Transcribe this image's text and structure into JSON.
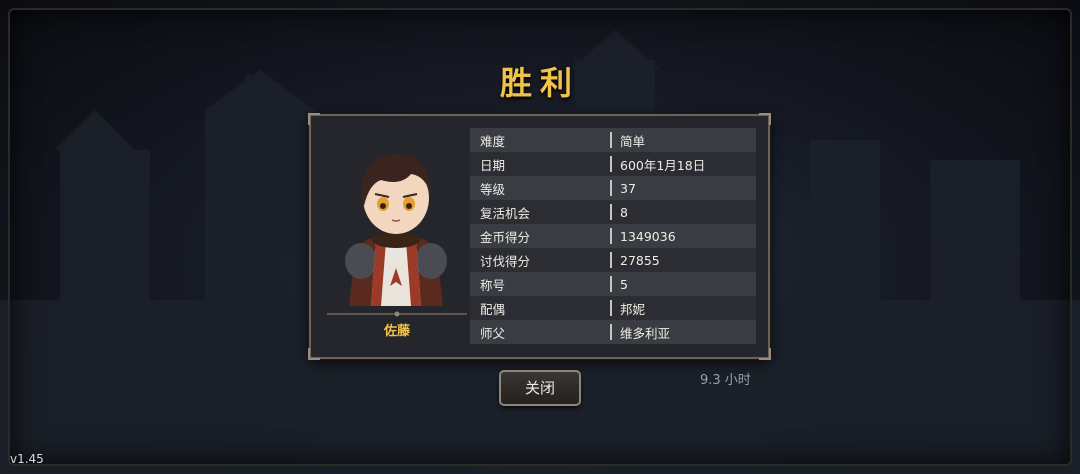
{
  "title": "胜利",
  "hero": {
    "name": "佐藤"
  },
  "stats": [
    {
      "label": "难度",
      "value": "简单"
    },
    {
      "label": "日期",
      "value": "600年1月18日"
    },
    {
      "label": "等级",
      "value": "37"
    },
    {
      "label": "复活机会",
      "value": "8"
    },
    {
      "label": "金币得分",
      "value": "1349036"
    },
    {
      "label": "讨伐得分",
      "value": "27855"
    },
    {
      "label": "称号",
      "value": "5"
    },
    {
      "label": "配偶",
      "value": "邦妮"
    },
    {
      "label": "师父",
      "value": "维多利亚"
    }
  ],
  "close_label": "关闭",
  "playtime": "9.3 小时",
  "version": "v1.45",
  "colors": {
    "accent": "#f2c24a",
    "panel": "#24262c",
    "border": "#6d6258"
  }
}
